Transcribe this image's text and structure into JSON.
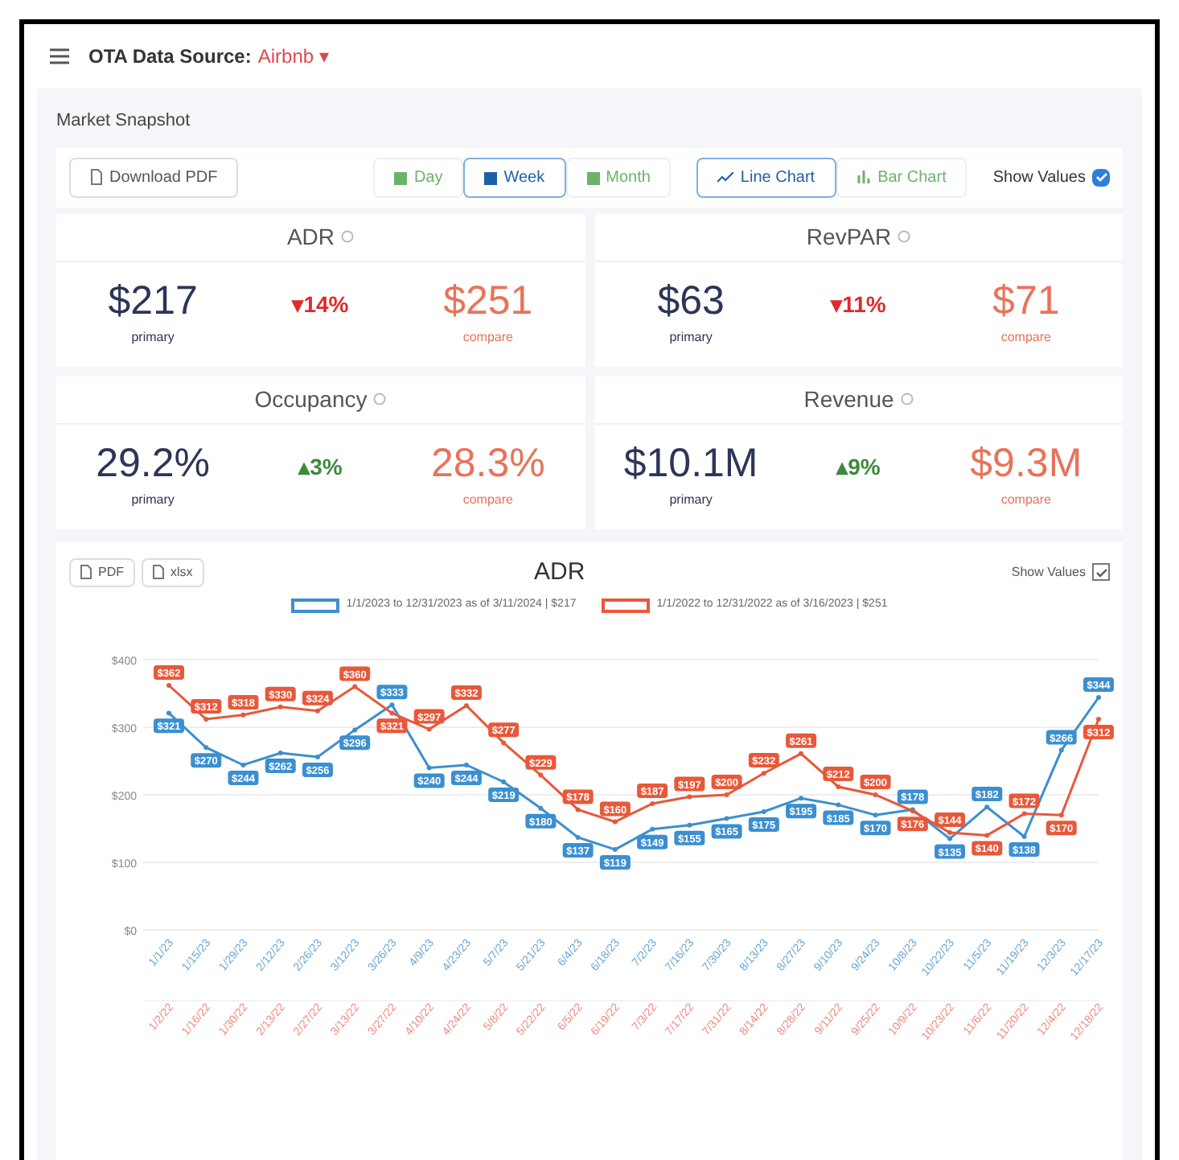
{
  "header": {
    "label": "OTA Data Source:",
    "source": "Airbnb",
    "caret": "▾"
  },
  "section_title": "Market Snapshot",
  "toolbar": {
    "download": "Download PDF",
    "periods": [
      {
        "label": "Day",
        "selected": false
      },
      {
        "label": "Week",
        "selected": true
      },
      {
        "label": "Month",
        "selected": false
      }
    ],
    "chart_types": [
      {
        "label": "Line Chart",
        "selected": true
      },
      {
        "label": "Bar Chart",
        "selected": false
      }
    ],
    "show_values": {
      "label": "Show Values",
      "checked": true
    }
  },
  "kpis": [
    {
      "title": "ADR",
      "primary": "$217",
      "primary_label": "primary",
      "change": "▾14%",
      "color": "#e02a2a",
      "compare": "$251",
      "compare_label": "compare"
    },
    {
      "title": "RevPAR",
      "primary": "$63",
      "primary_label": "primary",
      "change": "▾11%",
      "color": "#e02a2a",
      "compare": "$71",
      "compare_label": "compare"
    },
    {
      "title": "Occupancy",
      "primary": "29.2%",
      "primary_label": "primary",
      "change": "▴3%",
      "color": "#3b8a3b",
      "compare": "28.3%",
      "compare_label": "compare"
    },
    {
      "title": "Revenue",
      "primary": "$10.1M",
      "primary_label": "primary",
      "change": "▴9%",
      "color": "#3b8a3b",
      "compare": "$9.3M",
      "compare_label": "compare"
    }
  ],
  "chart_card": {
    "buttons": [
      "PDF",
      "xlsx"
    ],
    "show_values": {
      "label": "Show Values",
      "checked": true
    },
    "compare_axis_labels": [
      "1/2/22",
      "1/16/22",
      "1/30/22",
      "2/13/22",
      "2/27/22",
      "3/13/22",
      "3/27/22",
      "4/10/22",
      "4/24/22",
      "5/8/22",
      "5/22/22",
      "6/5/22",
      "6/19/22",
      "7/3/22",
      "7/17/22",
      "7/31/22",
      "8/14/22",
      "8/28/22",
      "9/11/22",
      "9/25/22",
      "10/9/22",
      "10/23/22",
      "11/6/22",
      "11/20/22",
      "12/4/22",
      "12/18/22"
    ],
    "chart_data": {
      "type": "line",
      "title": "ADR",
      "categories": [
        "1/1/23",
        "1/15/23",
        "1/29/23",
        "2/12/23",
        "2/26/23",
        "3/12/23",
        "3/26/23",
        "4/9/23",
        "4/23/23",
        "5/7/23",
        "5/21/23",
        "6/4/23",
        "6/18/23",
        "7/2/23",
        "7/16/23",
        "7/30/23",
        "8/13/23",
        "8/27/23",
        "9/10/23",
        "9/24/23",
        "10/8/23",
        "10/22/23",
        "11/5/23",
        "11/19/23",
        "12/3/23",
        "12/17/23"
      ],
      "yticks": [
        {
          "value": 0,
          "label": "$0"
        },
        {
          "value": 100,
          "label": "$100"
        },
        {
          "value": 200,
          "label": "$200"
        },
        {
          "value": 300,
          "label": "$300"
        },
        {
          "value": 400,
          "label": "$400"
        }
      ],
      "ylim": [
        0,
        400
      ],
      "grid": true,
      "series": [
        {
          "name": "1/1/2023 to 12/31/2023 as of 3/11/2024 | $217",
          "color": "#3b8fd0",
          "marker": "circle",
          "values": [
            321,
            270,
            244,
            262,
            256,
            296,
            333,
            240,
            244,
            219,
            180,
            137,
            119,
            149,
            155,
            165,
            175,
            195,
            185,
            170,
            178,
            135,
            182,
            138,
            266,
            344
          ],
          "value_labels": [
            "$321",
            "$270",
            "$244",
            "$262",
            "$256",
            "$296",
            "$333",
            "$240",
            "$244",
            "$219",
            "$180",
            "$137",
            "$119",
            "$149",
            "$155",
            "$165",
            "$175",
            "$195",
            "$185",
            "$170",
            "$178",
            "$135",
            "$182",
            "$138",
            "$266",
            "$344"
          ]
        },
        {
          "name": "1/1/2022 to 12/31/2022 as of 3/16/2023 | $251",
          "color": "#e8583a",
          "marker": "circle",
          "values": [
            362,
            312,
            318,
            330,
            324,
            360,
            321,
            297,
            332,
            277,
            229,
            178,
            160,
            187,
            197,
            200,
            232,
            261,
            212,
            200,
            176,
            144,
            140,
            172,
            170,
            312
          ],
          "value_labels": [
            "$362",
            "$312",
            "$318",
            "$330",
            "$324",
            "$360",
            "$321",
            "$297",
            "$332",
            "$277",
            "$229",
            "$178",
            "$160",
            "$187",
            "$197",
            "$200",
            "$232",
            "$261",
            "$212",
            "$200",
            "$176",
            "$144",
            "$140",
            "$172",
            "$170",
            "$312"
          ]
        }
      ]
    }
  }
}
